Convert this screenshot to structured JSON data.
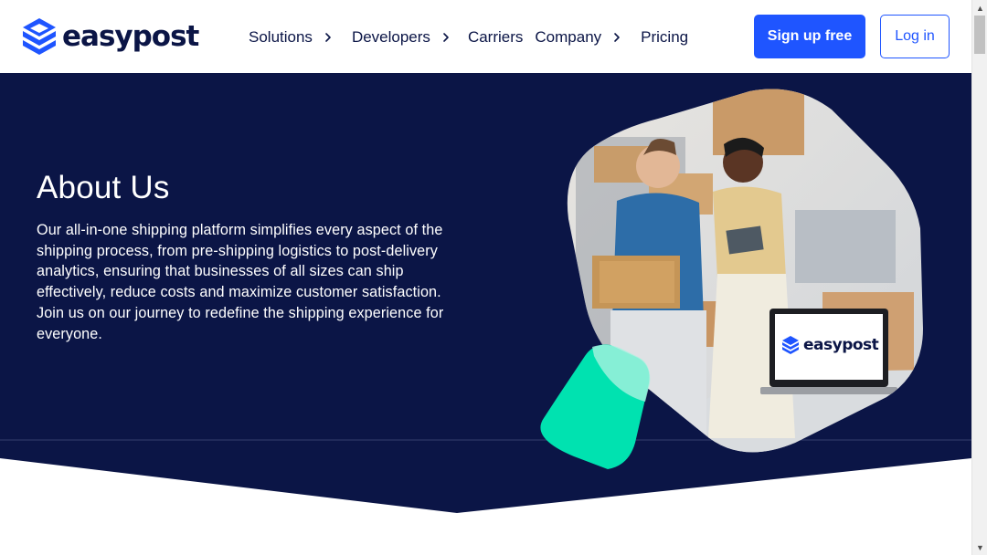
{
  "brand": {
    "name": "easypost"
  },
  "nav": {
    "items": [
      {
        "label": "Solutions",
        "has_dropdown": true
      },
      {
        "label": "Developers",
        "has_dropdown": true
      },
      {
        "label": "Carriers",
        "has_dropdown": false
      },
      {
        "label": "Company",
        "has_dropdown": true
      },
      {
        "label": "Pricing",
        "has_dropdown": false
      }
    ]
  },
  "header_actions": {
    "signup_label": "Sign up free",
    "login_label": "Log in"
  },
  "hero": {
    "title": "About Us",
    "body": "Our all-in-one shipping platform simplifies every aspect of the shipping process, from pre-shipping logistics to post-delivery analytics, ensuring that businesses of all sizes can ship effectively, reduce costs and maximize customer satisfaction. Join us on our journey to redefine the shipping experience for everyone.",
    "image_laptop_brand": "easypost"
  },
  "colors": {
    "navy": "#0b1546",
    "hero_bg": "#0b1546",
    "brand_blue": "#1f55ff",
    "accent_green": "#00e2b0"
  },
  "icons": [
    "chevron-right-icon",
    "easypost-logo-icon",
    "scroll-up-arrow-icon",
    "scroll-down-arrow-icon"
  ]
}
